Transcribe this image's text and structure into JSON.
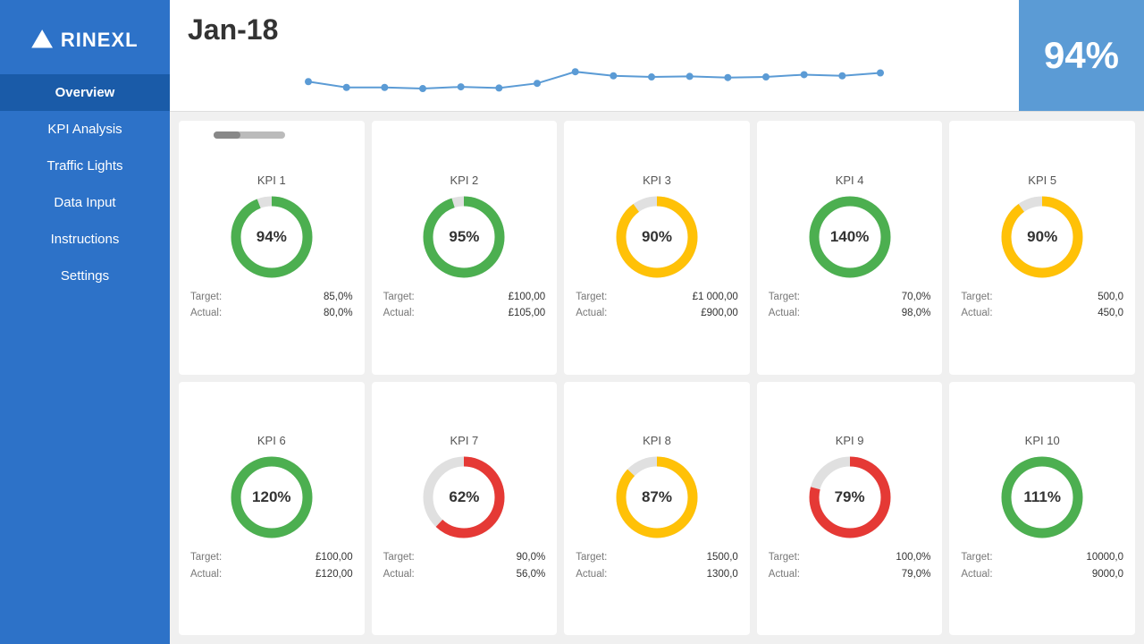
{
  "sidebar": {
    "logo_text": "RINEXL",
    "items": [
      {
        "id": "overview",
        "label": "Overview",
        "active": true
      },
      {
        "id": "kpi-analysis",
        "label": "KPI Analysis",
        "active": false
      },
      {
        "id": "traffic-lights",
        "label": "Traffic Lights",
        "active": false
      },
      {
        "id": "data-input",
        "label": "Data Input",
        "active": false
      },
      {
        "id": "instructions",
        "label": "Instructions",
        "active": false
      },
      {
        "id": "settings",
        "label": "Settings",
        "active": false
      }
    ]
  },
  "header": {
    "title": "Jan-18",
    "big_percent": "94%",
    "prev_btn": "‹",
    "next_btn": "›"
  },
  "kpis": [
    {
      "id": "kpi1",
      "label": "KPI 1",
      "percent": 94,
      "display": "94%",
      "color": "#4caf50",
      "bg": "#e0e0e0",
      "target_label": "Target:",
      "target_value": "85,0%",
      "actual_label": "Actual:",
      "actual_value": "80,0%"
    },
    {
      "id": "kpi2",
      "label": "KPI 2",
      "percent": 95,
      "display": "95%",
      "color": "#4caf50",
      "bg": "#e0e0e0",
      "target_label": "Target:",
      "target_value": "£100,00",
      "actual_label": "Actual:",
      "actual_value": "£105,00"
    },
    {
      "id": "kpi3",
      "label": "KPI 3",
      "percent": 90,
      "display": "90%",
      "color": "#ffc107",
      "bg": "#e0e0e0",
      "target_label": "Target:",
      "target_value": "£1 000,00",
      "actual_label": "Actual:",
      "actual_value": "£900,00"
    },
    {
      "id": "kpi4",
      "label": "KPI 4",
      "percent": 100,
      "display": "140%",
      "color": "#4caf50",
      "bg": "#e0e0e0",
      "target_label": "Target:",
      "target_value": "70,0%",
      "actual_label": "Actual:",
      "actual_value": "98,0%"
    },
    {
      "id": "kpi5",
      "label": "KPI 5",
      "percent": 90,
      "display": "90%",
      "color": "#ffc107",
      "bg": "#e0e0e0",
      "target_label": "Target:",
      "target_value": "500,0",
      "actual_label": "Actual:",
      "actual_value": "450,0"
    },
    {
      "id": "kpi6",
      "label": "KPI 6",
      "percent": 100,
      "display": "120%",
      "color": "#4caf50",
      "bg": "#e0e0e0",
      "target_label": "Target:",
      "target_value": "£100,00",
      "actual_label": "Actual:",
      "actual_value": "£120,00"
    },
    {
      "id": "kpi7",
      "label": "KPI 7",
      "percent": 62,
      "display": "62%",
      "color": "#e53935",
      "bg": "#e0e0e0",
      "target_label": "Target:",
      "target_value": "90,0%",
      "actual_label": "Actual:",
      "actual_value": "56,0%"
    },
    {
      "id": "kpi8",
      "label": "KPI 8",
      "percent": 87,
      "display": "87%",
      "color": "#ffc107",
      "bg": "#e0e0e0",
      "target_label": "Target:",
      "target_value": "1500,0",
      "actual_label": "Actual:",
      "actual_value": "1300,0"
    },
    {
      "id": "kpi9",
      "label": "KPI 9",
      "percent": 79,
      "display": "79%",
      "color": "#e53935",
      "bg": "#e0e0e0",
      "target_label": "Target:",
      "target_value": "100,0%",
      "actual_label": "Actual:",
      "actual_value": "79,0%"
    },
    {
      "id": "kpi10",
      "label": "KPI 10",
      "percent": 100,
      "display": "111%",
      "color": "#4caf50",
      "bg": "#e0e0e0",
      "target_label": "Target:",
      "target_value": "10000,0",
      "actual_label": "Actual:",
      "actual_value": "9000,0"
    }
  ],
  "chart": {
    "points": [
      0.55,
      0.45,
      0.45,
      0.43,
      0.46,
      0.44,
      0.52,
      0.72,
      0.65,
      0.63,
      0.64,
      0.62,
      0.63,
      0.67,
      0.65,
      0.7
    ],
    "color": "#5b9bd5"
  }
}
